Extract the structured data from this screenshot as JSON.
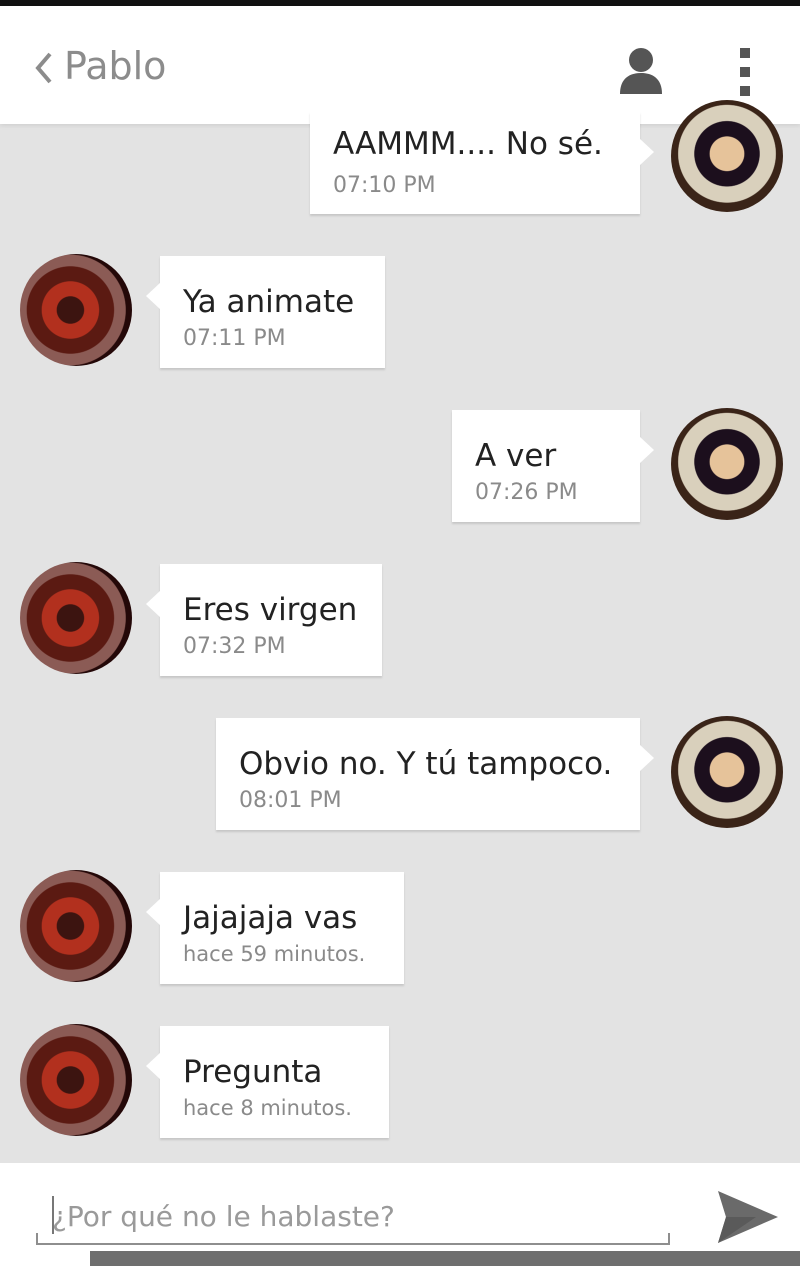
{
  "header": {
    "contact_name": "Pablo",
    "back_icon": "chevron-left-icon",
    "profile_icon": "person-icon",
    "menu_icon": "overflow-menu-icon"
  },
  "messages": [
    {
      "direction": "outgoing",
      "text": "AAMMM.... No sé.",
      "time": "07:10 PM"
    },
    {
      "direction": "incoming",
      "text": "Ya animate",
      "time": "07:11 PM"
    },
    {
      "direction": "outgoing",
      "text": "A ver",
      "time": "07:26 PM"
    },
    {
      "direction": "incoming",
      "text": "Eres virgen",
      "time": "07:32 PM"
    },
    {
      "direction": "outgoing",
      "text": "Obvio no. Y tú tampoco.",
      "time": "08:01 PM"
    },
    {
      "direction": "incoming",
      "text": "Jajajaja vas",
      "time": "hace 59 minutos."
    },
    {
      "direction": "incoming",
      "text": "Pregunta",
      "time": "hace 8 minutos."
    }
  ],
  "composer": {
    "placeholder": "¿Por qué no le hablaste?",
    "value": "",
    "send_icon": "send-icon"
  },
  "colors": {
    "background": "#e3e3e3",
    "bubble": "#ffffff",
    "header": "#ffffff",
    "icon": "#555555"
  }
}
